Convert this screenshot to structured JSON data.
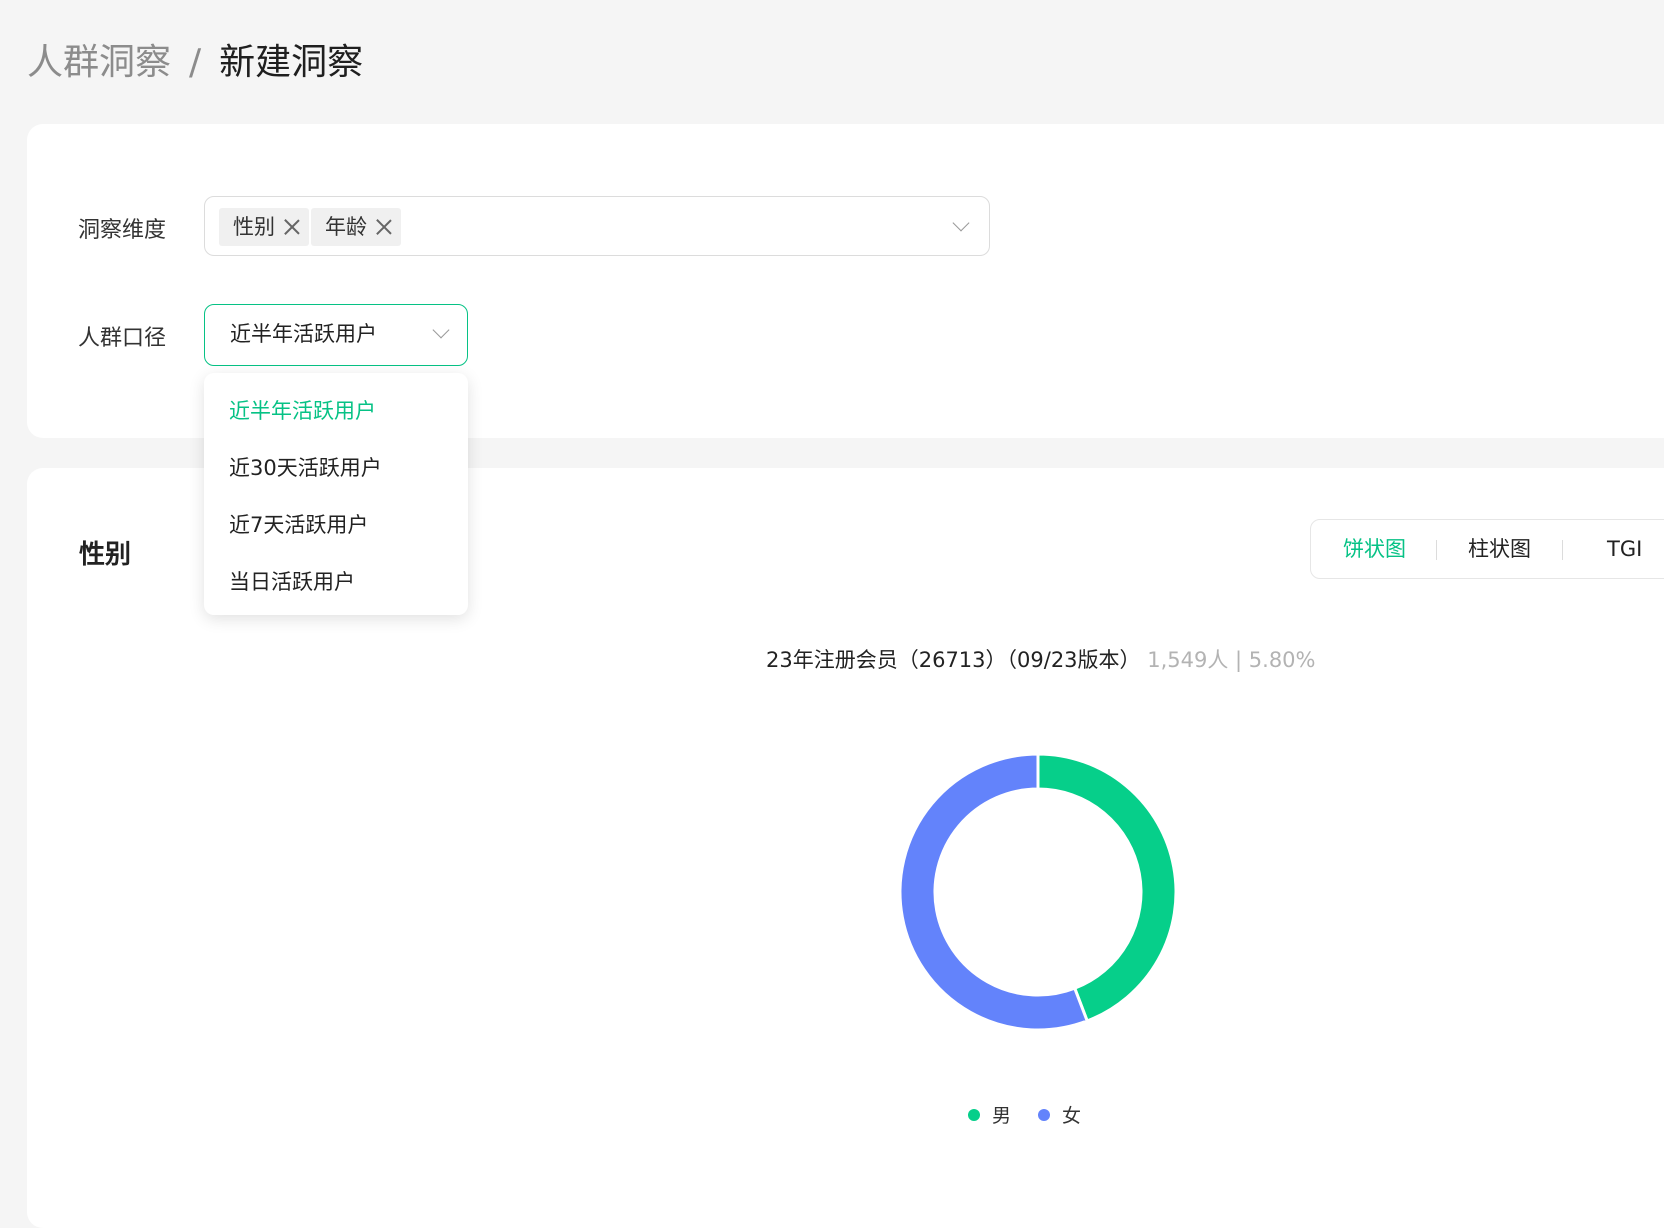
{
  "breadcrumb": {
    "parent": "人群洞察",
    "separator": "/",
    "current": "新建洞察"
  },
  "filters": {
    "dimension_label": "洞察维度",
    "dimension_tags": [
      "性别",
      "年龄"
    ],
    "crowd_label": "人群口径",
    "crowd_value": "近半年活跃用户",
    "crowd_options": [
      "近半年活跃用户",
      "近30天活跃用户",
      "近7天活跃用户",
      "当日活跃用户"
    ],
    "crowd_selected_index": 0
  },
  "section": {
    "title": "性别",
    "view_tabs": [
      "饼状图",
      "柱状图",
      "TGI"
    ],
    "active_tab": "饼状图"
  },
  "chart_caption": {
    "main": "23年注册会员（26713）（09/23版本）",
    "stats": "1,549人 | 5.80%"
  },
  "colors": {
    "accent": "#06c285",
    "male": "#06cf8a",
    "female": "#6383fb"
  },
  "chart_data": {
    "type": "pie",
    "categories": [
      "男",
      "女"
    ],
    "values": [
      44.2,
      55.8
    ],
    "legend": "bottom"
  }
}
